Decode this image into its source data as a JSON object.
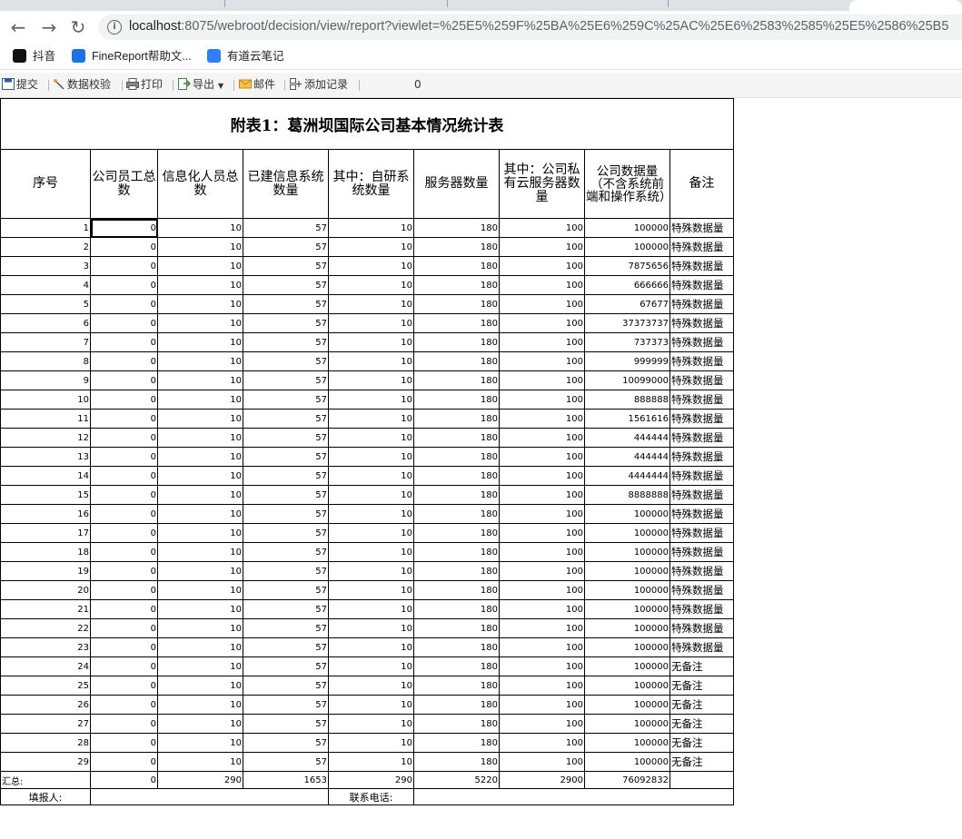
{
  "browser": {
    "url_host": "localhost",
    "url_path": ":8075/webroot/decision/view/report?viewlet=%25E5%259F%25BA%25E6%259C%25AC%25E6%2583%2585%25E5%2586%25B5",
    "bookmarks": [
      {
        "label": "抖音",
        "icon": "tiktok-icon",
        "color": "#111111"
      },
      {
        "label": "FineReport帮助文...",
        "icon": "finereport-icon",
        "color": "#1a73e8"
      },
      {
        "label": "有道云笔记",
        "icon": "youdao-note-icon",
        "color": "#2d7ff9"
      }
    ]
  },
  "toolbar": {
    "submit": "提交",
    "verify": "数据校验",
    "print": "打印",
    "export": "导出",
    "mail": "邮件",
    "add_record": "添加记录",
    "counter": "0"
  },
  "report": {
    "title": "附表1：葛洲坝国际公司基本情况统计表",
    "headers": [
      "序号",
      "公司员工总数",
      "信息化人员总数",
      "已建信息系统数量",
      "其中：自研系统数量",
      "服务器数量",
      "其中：公司私有云服务器数量",
      "公司数据量（不含系统前端和操作系统）",
      "备注"
    ],
    "rows": [
      [
        "1",
        "0",
        "10",
        "57",
        "10",
        "180",
        "100",
        "100000",
        "特殊数据量"
      ],
      [
        "2",
        "0",
        "10",
        "57",
        "10",
        "180",
        "100",
        "100000",
        "特殊数据量"
      ],
      [
        "3",
        "0",
        "10",
        "57",
        "10",
        "180",
        "100",
        "7875656",
        "特殊数据量"
      ],
      [
        "4",
        "0",
        "10",
        "57",
        "10",
        "180",
        "100",
        "666666",
        "特殊数据量"
      ],
      [
        "5",
        "0",
        "10",
        "57",
        "10",
        "180",
        "100",
        "67677",
        "特殊数据量"
      ],
      [
        "6",
        "0",
        "10",
        "57",
        "10",
        "180",
        "100",
        "37373737",
        "特殊数据量"
      ],
      [
        "7",
        "0",
        "10",
        "57",
        "10",
        "180",
        "100",
        "737373",
        "特殊数据量"
      ],
      [
        "8",
        "0",
        "10",
        "57",
        "10",
        "180",
        "100",
        "999999",
        "特殊数据量"
      ],
      [
        "9",
        "0",
        "10",
        "57",
        "10",
        "180",
        "100",
        "10099000",
        "特殊数据量"
      ],
      [
        "10",
        "0",
        "10",
        "57",
        "10",
        "180",
        "100",
        "888888",
        "特殊数据量"
      ],
      [
        "11",
        "0",
        "10",
        "57",
        "10",
        "180",
        "100",
        "1561616",
        "特殊数据量"
      ],
      [
        "12",
        "0",
        "10",
        "57",
        "10",
        "180",
        "100",
        "444444",
        "特殊数据量"
      ],
      [
        "13",
        "0",
        "10",
        "57",
        "10",
        "180",
        "100",
        "444444",
        "特殊数据量"
      ],
      [
        "14",
        "0",
        "10",
        "57",
        "10",
        "180",
        "100",
        "4444444",
        "特殊数据量"
      ],
      [
        "15",
        "0",
        "10",
        "57",
        "10",
        "180",
        "100",
        "8888888",
        "特殊数据量"
      ],
      [
        "16",
        "0",
        "10",
        "57",
        "10",
        "180",
        "100",
        "100000",
        "特殊数据量"
      ],
      [
        "17",
        "0",
        "10",
        "57",
        "10",
        "180",
        "100",
        "100000",
        "特殊数据量"
      ],
      [
        "18",
        "0",
        "10",
        "57",
        "10",
        "180",
        "100",
        "100000",
        "特殊数据量"
      ],
      [
        "19",
        "0",
        "10",
        "57",
        "10",
        "180",
        "100",
        "100000",
        "特殊数据量"
      ],
      [
        "20",
        "0",
        "10",
        "57",
        "10",
        "180",
        "100",
        "100000",
        "特殊数据量"
      ],
      [
        "21",
        "0",
        "10",
        "57",
        "10",
        "180",
        "100",
        "100000",
        "特殊数据量"
      ],
      [
        "22",
        "0",
        "10",
        "57",
        "10",
        "180",
        "100",
        "100000",
        "特殊数据量"
      ],
      [
        "23",
        "0",
        "10",
        "57",
        "10",
        "180",
        "100",
        "100000",
        "特殊数据量"
      ],
      [
        "24",
        "0",
        "10",
        "57",
        "10",
        "180",
        "100",
        "100000",
        "无备注"
      ],
      [
        "25",
        "0",
        "10",
        "57",
        "10",
        "180",
        "100",
        "100000",
        "无备注"
      ],
      [
        "26",
        "0",
        "10",
        "57",
        "10",
        "180",
        "100",
        "100000",
        "无备注"
      ],
      [
        "27",
        "0",
        "10",
        "57",
        "10",
        "180",
        "100",
        "100000",
        "无备注"
      ],
      [
        "28",
        "0",
        "10",
        "57",
        "10",
        "180",
        "100",
        "100000",
        "无备注"
      ],
      [
        "29",
        "0",
        "10",
        "57",
        "10",
        "180",
        "100",
        "100000",
        "无备注"
      ]
    ],
    "summary": [
      "汇总:",
      "0",
      "290",
      "1653",
      "290",
      "5220",
      "2900",
      "76092832",
      ""
    ],
    "footer": {
      "reporter": "填报人:",
      "phone": "联系电话:"
    }
  }
}
